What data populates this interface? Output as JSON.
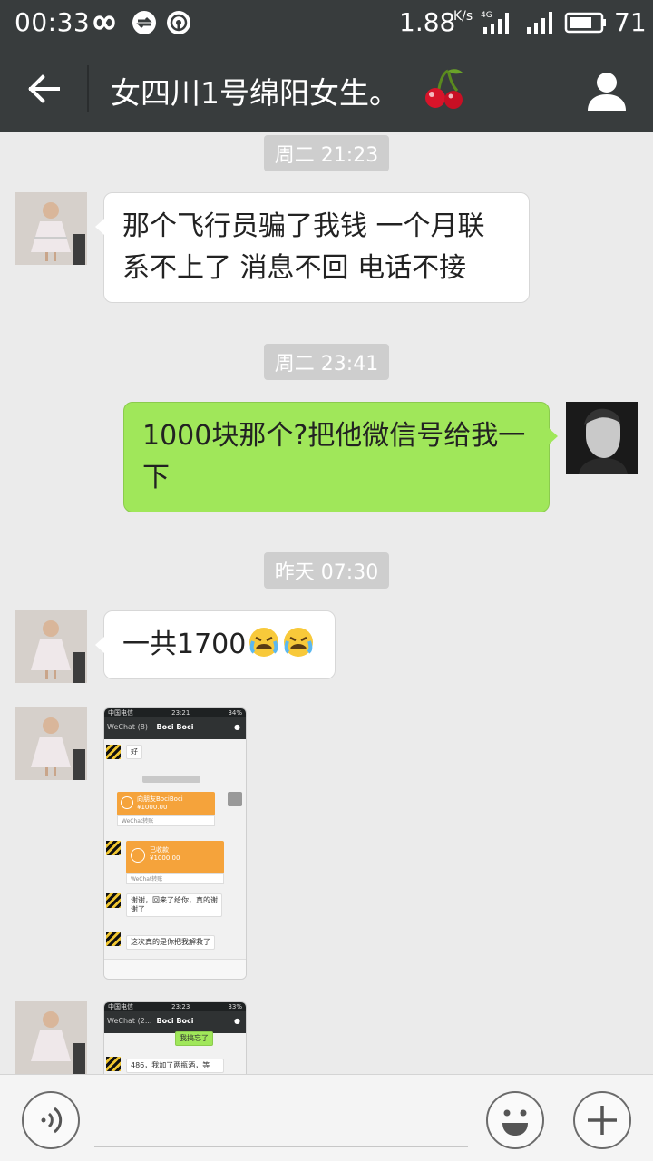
{
  "status_bar": {
    "time": "00:33",
    "net_speed": "1.88",
    "net_speed_unit": "K/s",
    "network_type": "4G",
    "battery_percent": "71",
    "icons": [
      "infinity-icon",
      "sync-icon",
      "wifi-radar-icon",
      "signal-icon",
      "battery-icon"
    ]
  },
  "header": {
    "title": "女四川1号绵阳女生。",
    "title_emoji": "cherry-icon",
    "back_icon": "arrow-left-icon",
    "profile_icon": "person-icon"
  },
  "messages": [
    {
      "type": "time",
      "text": "周二 21:23"
    },
    {
      "type": "text",
      "from": "other",
      "text": "那个飞行员骗了我钱 一个月联系不上了 消息不回 电话不接"
    },
    {
      "type": "time",
      "text": "周二 23:41"
    },
    {
      "type": "text",
      "from": "me",
      "text": "1000块那个?把他微信号给我一下"
    },
    {
      "type": "time",
      "text": "昨天 07:30"
    },
    {
      "type": "text",
      "from": "other",
      "text": "一共1700",
      "emoji": [
        "crying-face-icon",
        "crying-face-icon"
      ]
    },
    {
      "type": "image",
      "from": "other",
      "screenshot": {
        "carrier": "中国电信",
        "time": "23:21",
        "battery": "34%",
        "back_label": "WeChat (8)",
        "name": "Boci Boci",
        "msgs": [
          "好",
          "谢谢，回来了给你，真的谢谢了",
          "这次真的是你把我解救了"
        ],
        "transfer_title": "向朋友BociBoci",
        "transfer_amount": "¥1000.00",
        "transfer_footer": "WeChat转账",
        "received_title": "已收款",
        "received_amount": "¥1000.00",
        "received_footer": "WeChat转账"
      }
    },
    {
      "type": "image",
      "from": "other",
      "screenshot": {
        "carrier": "中国电信",
        "time": "23:23",
        "battery": "33%",
        "back_label": "WeChat (2...",
        "name": "Boci Boci",
        "msgs": [
          "我搞忘了",
          "486，我加了两瓶酒，等"
        ]
      }
    }
  ],
  "input_bar": {
    "placeholder": "",
    "voice_icon": "voice-icon",
    "emoji_icon": "smiley-icon",
    "plus_icon": "plus-icon"
  }
}
